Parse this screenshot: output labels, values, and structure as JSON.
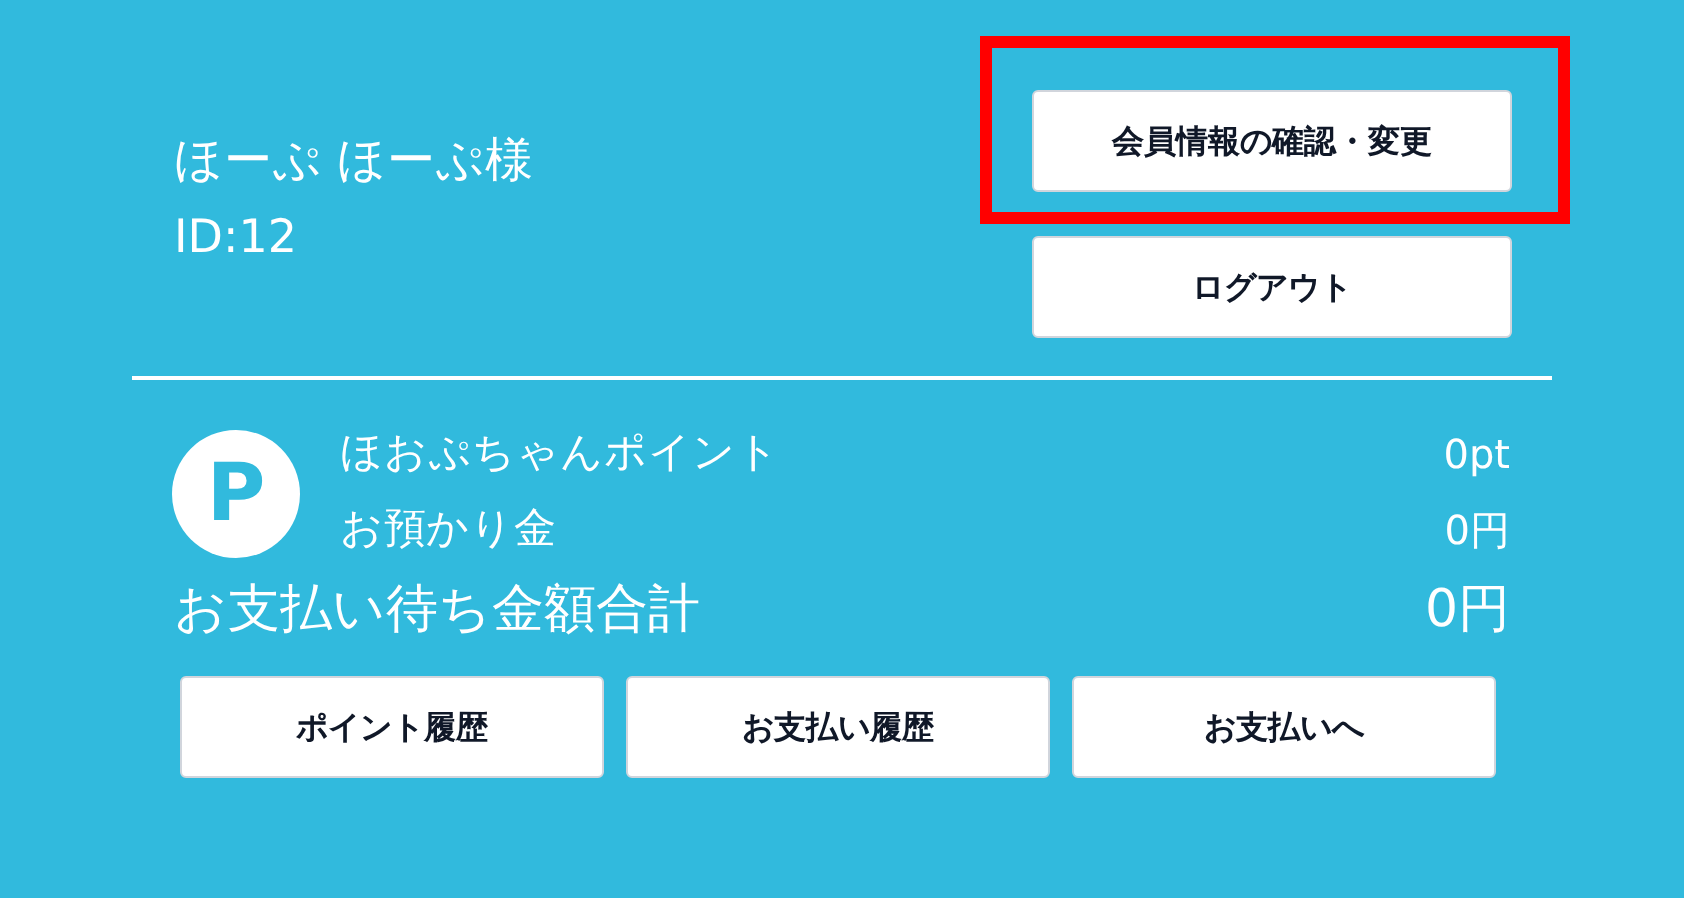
{
  "member": {
    "name": "ほーぷ ほーぷ様",
    "id": "ID:12"
  },
  "account_buttons": [
    {
      "label": "会員情報の確認・変更",
      "highlighted": true
    },
    {
      "label": "ログアウト",
      "highlighted": false
    }
  ],
  "point_badge": "P",
  "balances": [
    {
      "label": "ほおぷちゃんポイント",
      "value": "0pt"
    },
    {
      "label": "お預かり金",
      "value": "0円"
    }
  ],
  "total": {
    "label": "お支払い待ち金額合計",
    "value": "0円"
  },
  "actions": [
    "ポイント履歴",
    "お支払い履歴",
    "お支払いへ"
  ]
}
